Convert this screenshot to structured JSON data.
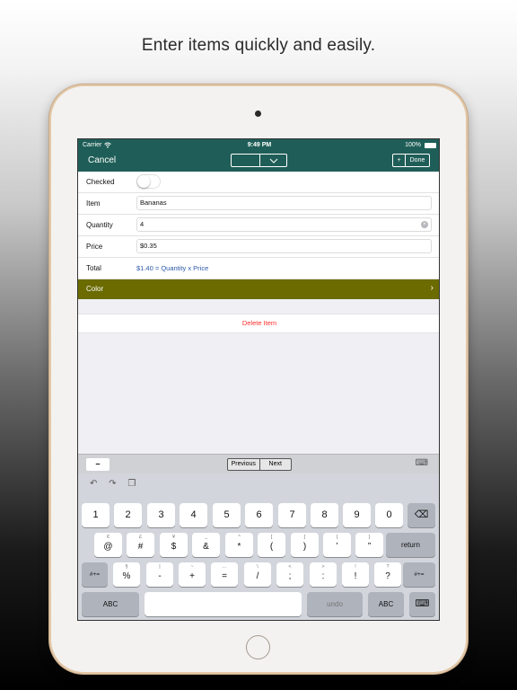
{
  "headline": "Enter items quickly and easily.",
  "status": {
    "carrier": "Carrier",
    "wifi_icon": "wifi-icon",
    "time": "9:49 PM",
    "battery": "100%"
  },
  "nav": {
    "cancel": "Cancel",
    "add": "+",
    "done": "Done"
  },
  "form": {
    "checked_label": "Checked",
    "checked_value": false,
    "item_label": "Item",
    "item_value": "Bananas",
    "quantity_label": "Quantity",
    "quantity_value": "4",
    "price_label": "Price",
    "price_value": "$0.35",
    "total_label": "Total",
    "total_value": "$1.40 = Quantity x Price",
    "color_label": "Color",
    "color_swatch": "#6b6b00"
  },
  "delete_label": "Delete Item",
  "accessory": {
    "minus": "–",
    "previous": "Previous",
    "next": "Next"
  },
  "keyboard": {
    "numbers": [
      "1",
      "2",
      "3",
      "4",
      "5",
      "6",
      "7",
      "8",
      "9",
      "0"
    ],
    "row2": [
      {
        "hint": "€",
        "main": "@"
      },
      {
        "hint": "£",
        "main": "#"
      },
      {
        "hint": "¥",
        "main": "$"
      },
      {
        "hint": "_",
        "main": "&"
      },
      {
        "hint": "^",
        "main": "*"
      },
      {
        "hint": "[",
        "main": "("
      },
      {
        "hint": "]",
        "main": ")"
      },
      {
        "hint": "{",
        "main": "’"
      },
      {
        "hint": "}",
        "main": "”"
      }
    ],
    "return": "return",
    "row3": [
      {
        "hint": "§",
        "main": "%"
      },
      {
        "hint": "|",
        "main": "-"
      },
      {
        "hint": "~",
        "main": "+"
      },
      {
        "hint": "…",
        "main": "="
      },
      {
        "hint": "\\",
        "main": "/"
      },
      {
        "hint": "<",
        "main": ";"
      },
      {
        "hint": ">",
        "main": ":"
      },
      {
        "hint": "!",
        "main": "!"
      },
      {
        "hint": "?",
        "main": "?"
      }
    ],
    "shift_left": "#+=",
    "shift_right": "#+=",
    "abc_left": "ABC",
    "undo": "undo",
    "abc_right": "ABC"
  }
}
